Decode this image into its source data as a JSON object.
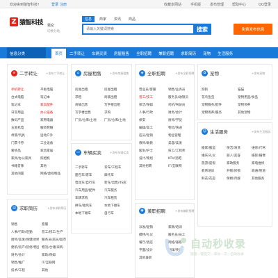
{
  "topbar": {
    "welcome": "欢迎来到猿智科技！",
    "login": "登录",
    "register": "注册",
    "newsletter": "收藏本网站",
    "mobile": "手机版",
    "post_mgmt": "发布管理",
    "help": "帮助中心",
    "qq": "QQ登录"
  },
  "header": {
    "logo_text": "猿智科技",
    "city": "昆仑",
    "city_sub": "切换分站"
  },
  "search": {
    "tabs": [
      "信息",
      "商家",
      "资讯",
      "商品"
    ],
    "placeholder": "请输入关键词搜索",
    "button": "搜索"
  },
  "post_button": "免费发布信息",
  "nav": {
    "category": "信息分类",
    "items": [
      "首页",
      "二手转让",
      "车辆买卖",
      "房屋租售",
      "全职招聘",
      "兼职招聘",
      "求职简历",
      "宠物",
      "生活服务"
    ]
  },
  "sections": {
    "secondhand": {
      "title": "二手转让",
      "more": "+发布二手转让",
      "items": [
        "手机转让",
        "平板电脑",
        "台式电脑",
        "笔记本",
        "笔记本",
        "家具配件",
        "日常用品",
        "办公设备",
        "数码产品",
        "家用电器",
        "五金机电",
        "服装鞋帽",
        "母婴/玩具",
        "运动户外",
        "门票卡券",
        "工业设备",
        "奢侈品",
        "家具家居",
        "家具/办公家具",
        "照相机",
        "书籍音像",
        "其他",
        "其他闲置",
        "网络/虚拟物品"
      ]
    },
    "house": {
      "title": "房屋租售",
      "more": "+发布房屋租售",
      "items": [
        "房屋出租",
        "房屋出租",
        "求租",
        "商铺出租",
        "商铺出售",
        "写字楼出租",
        "写字楼出售",
        "求购",
        "厂房/仓库/土地",
        "厂房/仓库/土地"
      ]
    },
    "fulltime": {
      "title": "全职招聘",
      "more": "+发布全职招聘",
      "items": [
        "营业员/客服",
        "销售/业务员",
        "普工/技工",
        "服务员/收银员",
        "保洁/保姆",
        "司机/驾驶员",
        "人事/行政",
        "财务/会计",
        "保安",
        "厨师/学徒",
        "编辑/美工",
        "物流/快递",
        "店员/促销",
        "物业管理",
        "教师/助教",
        "美容/美发",
        "医生/护士",
        "技工/工程师",
        "设计/策划",
        "KTV/酒吧",
        "其他招聘",
        "IT/互联网"
      ]
    },
    "pets": {
      "title": "宠物",
      "more": "+发布宠物",
      "items": [
        "狗狗",
        "猫猫",
        "花鸟鱼虫",
        "宠物用品/食品",
        "宠物服务/配件",
        "宠物领养",
        "宠物寄养/服务",
        "其他宠物"
      ]
    },
    "life": {
      "title": "生活服务",
      "more": "+发布生活服务",
      "items": [
        "搬家/搬运",
        "保洁/清洗",
        "维修/代驾",
        "婚庆/礼仪",
        "丽人/美容",
        "摄影/摄像",
        "旅游/度假",
        "家政服务",
        "家电维修",
        "教育培训",
        "开锁/修锁",
        "疏通/管道",
        "鲜花/花店",
        "保姆/月嫂",
        "其他服务"
      ]
    },
    "car": {
      "title": "车辆买卖",
      "more": "+发布车辆买卖",
      "items": [
        "二手轿车",
        "货车/工程车",
        "面包车/客车",
        "摩托车",
        "电动车/自行车",
        "新车/出售/4S店",
        "汽车用品/配件",
        "汽车服务",
        "车辆求购",
        "汽车租赁",
        "拼车/顺风车",
        "本地下顺车",
        "本地下顺车",
        "自行车"
      ]
    },
    "parttime": {
      "title": "兼职招聘",
      "more": "+发布兼职招聘",
      "items": [
        "派发/促销",
        "家教/培训",
        "模特/礼仪",
        "服务员/员工",
        "餐厅/酒店",
        "网络/兼职",
        "平面/设计",
        "翻译/英语",
        "其他兼职"
      ]
    },
    "resume": {
      "title": "求职简历",
      "more": "+发布求职简历",
      "items": [
        "销售",
        "客服",
        "人事/行政/后勤",
        "普工/技工/生产",
        "厨师/美发/保健/厨师",
        "服务员/店员/超市",
        "建筑/房产/装修/物业",
        "物流/仓储/采购",
        "财务/会计",
        "家政/保姆",
        "销售/推广",
        "IT/互联网",
        "技术/工程",
        "其他"
      ]
    }
  },
  "watermark": {
    "brand": "自动秒收录",
    "slogan": "链接一键提交—来访一次—自动收录"
  },
  "colors": {
    "primary": "#1a7ad9",
    "accent": "#ff6600",
    "logo": "#e0241c"
  }
}
